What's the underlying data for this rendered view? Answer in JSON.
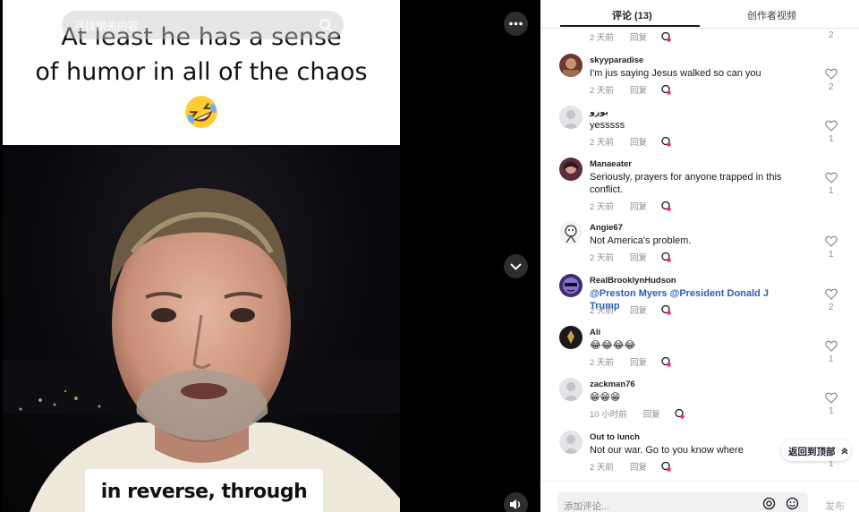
{
  "video": {
    "caption_top_line1": "At least he has a sense",
    "caption_top_line2": "of humor in all of the chaos",
    "caption_top_emoji": "rolling-on-floor-laughing-emoji",
    "search_placeholder": "寻找相关内容",
    "caption_bottom": "in reverse, through the",
    "controls": {
      "more": "more-icon",
      "down": "chevron-down-icon",
      "volume": "volume-icon"
    }
  },
  "panel": {
    "tabs": [
      {
        "label": "评论 (13)",
        "active": true
      },
      {
        "label": "创作者视频",
        "active": false
      }
    ],
    "reply_label": "回复",
    "comments": [
      {
        "user": "",
        "text": "",
        "time": "2 天前",
        "likes": "2"
      },
      {
        "user": "skyyparadise",
        "text": "I'm jus saying Jesus walked so can you",
        "time": "2 天前",
        "likes": "2"
      },
      {
        "user": "بورو",
        "text": "yesssss",
        "time": "2 天前",
        "likes": "1"
      },
      {
        "user": "Manaeater",
        "text": "Seriously, prayers for anyone trapped in this conflict.",
        "time": "2 天前",
        "likes": "1"
      },
      {
        "user": "Angie67",
        "text": "Not America's problem.",
        "time": "2 天前",
        "likes": "1"
      },
      {
        "user": "RealBrooklynHudson",
        "text": "@Preston Myers @President Donald J Trump",
        "time": "2 天前",
        "likes": "2"
      },
      {
        "user": "Ali",
        "text": "😂😂😂😂",
        "time": "2 天前",
        "likes": "1"
      },
      {
        "user": "zackman76",
        "text": "😁😁😁",
        "time": "10 小时前",
        "likes": "1"
      },
      {
        "user": "Out to lunch",
        "text": "Not our war. Go to you know where",
        "time": "2 天前",
        "likes": "1"
      }
    ],
    "back_to_top": "返回到顶部",
    "comment_placeholder": "添加评论...",
    "post_label": "发布"
  },
  "colors": {
    "accent_mention": "#2b5db8",
    "muted": "#8a8b91",
    "tab_underline": "#161823"
  }
}
